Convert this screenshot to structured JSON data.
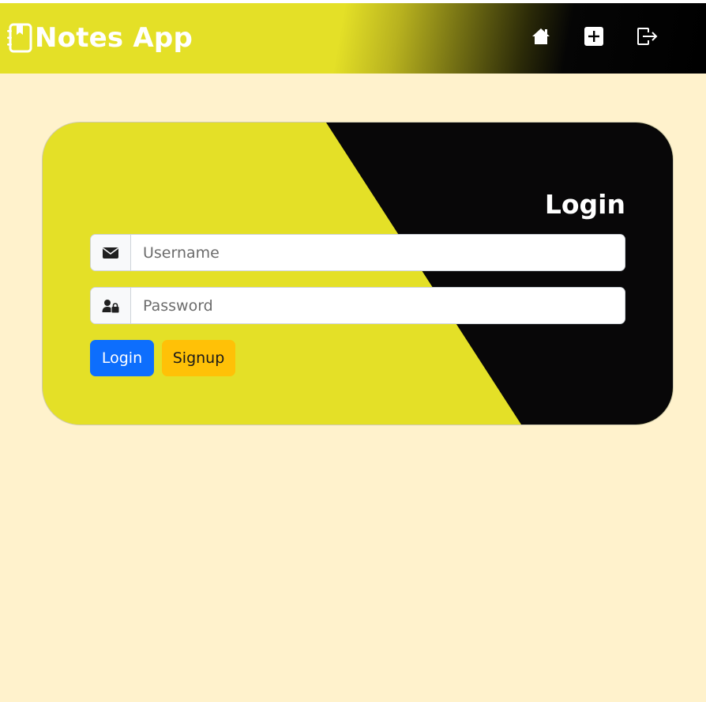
{
  "navbar": {
    "brand_title": "Notes App",
    "icons": {
      "brand": "notebook-icon",
      "home": "house-icon",
      "add": "plus-square-icon",
      "logout": "logout-icon"
    }
  },
  "login_card": {
    "heading": "Login",
    "username": {
      "placeholder": "Username",
      "value": "",
      "icon": "envelope-icon"
    },
    "password": {
      "placeholder": "Password",
      "value": "",
      "icon": "user-lock-icon"
    },
    "login_button": "Login",
    "signup_button": "Signup"
  },
  "colors": {
    "page_background": "#fff2cc",
    "accent_yellow": "#e4e027",
    "dark": "#080708",
    "primary_blue": "#0d6efd",
    "warning_yellow": "#ffc107"
  }
}
